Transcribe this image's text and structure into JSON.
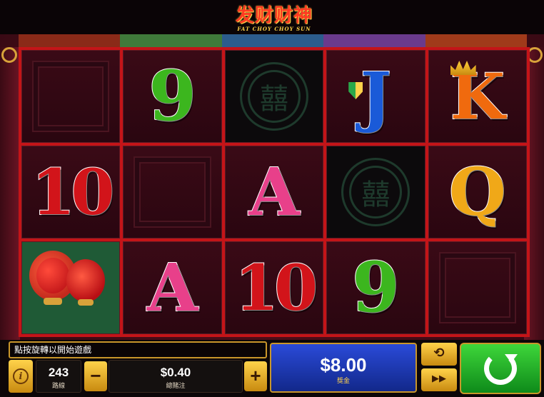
{
  "game": {
    "logo_cn": "发财财神",
    "logo_en": "FAT CHOY CHOY SUN"
  },
  "reels": [
    [
      "empty",
      "10",
      "lantern"
    ],
    [
      "9",
      "empty",
      "A"
    ],
    [
      "coin",
      "A",
      "10"
    ],
    [
      "J",
      "coin",
      "9"
    ],
    [
      "K",
      "Q",
      "empty"
    ]
  ],
  "symbols": {
    "nine": "9",
    "ten": "10",
    "jack": "J",
    "king": "K",
    "queen": "Q",
    "ace": "A",
    "coin_glyph": "囍"
  },
  "hud": {
    "message": "點按旋轉以開始遊戲",
    "lines_value": "243",
    "lines_label": "路線",
    "bet_value": "$0.40",
    "bet_label": "總賭注",
    "win_value": "$8.00",
    "win_label": "獎金",
    "minus_label": "−",
    "plus_label": "+",
    "info_glyph": "i",
    "autoplay_glyph": "⟲",
    "fast_glyph": "▶▶"
  },
  "colors": {
    "reel_frame": "#c41418",
    "spin_button": "#2ab82e",
    "win_panel": "#1e3ab8",
    "gold": "#d8a23a"
  },
  "icons": {
    "info": "info-icon",
    "autoplay": "autoplay-icon",
    "fast_forward": "fast-forward-icon",
    "spin": "spin-icon"
  }
}
